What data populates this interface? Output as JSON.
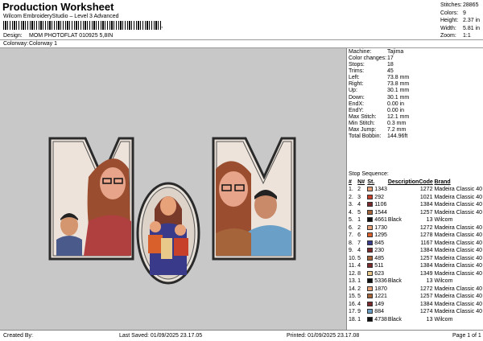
{
  "header": {
    "title": "Production Worksheet",
    "subtitle": "Wilcom EmbroideryStudio – Level 3 Advanced",
    "barcode_suffix": ","
  },
  "design": {
    "label": "Design:",
    "value": "MOM PHOTOFLAT 010925 5,8IN"
  },
  "colorway": {
    "label": "Colorway:",
    "value": "Colorway 1"
  },
  "stats": [
    {
      "label": "Stitches:",
      "value": "28865"
    },
    {
      "label": "Colors:",
      "value": "9"
    },
    {
      "label": "Height:",
      "value": "2.37 in"
    },
    {
      "label": "Width:",
      "value": "5.81 in"
    },
    {
      "label": "Zoom:",
      "value": "1:1"
    }
  ],
  "machine": [
    {
      "label": "Machine:",
      "value": "Tajima"
    },
    {
      "label": "Color changes:",
      "value": "17"
    },
    {
      "label": "Stops:",
      "value": "18"
    },
    {
      "label": "Trims:",
      "value": "45"
    },
    {
      "label": "Left:",
      "value": "73.8 mm"
    },
    {
      "label": "Right:",
      "value": "73.8 mm"
    },
    {
      "label": "Up:",
      "value": "30.1 mm"
    },
    {
      "label": "Down:",
      "value": "30.1 mm"
    },
    {
      "label": "EndX:",
      "value": "0.00 in"
    },
    {
      "label": "EndY:",
      "value": "0.00 in"
    },
    {
      "label": "Max Stitch:",
      "value": "12.1 mm"
    },
    {
      "label": "Min Stitch:",
      "value": "0.3 mm"
    },
    {
      "label": "Max Jump:",
      "value": "7.2 mm"
    },
    {
      "label": "Total Bobbin:",
      "value": "144.96ft"
    }
  ],
  "sequence": {
    "title": "Stop Sequence:",
    "headers": [
      "#",
      "N#",
      "St.",
      "Description",
      "Code",
      "Brand"
    ],
    "rows": [
      {
        "n": "1.",
        "nn": "2",
        "color": "#e8a27a",
        "st": "1343",
        "desc": "",
        "code": "1272",
        "brand": "Madeira Classic 40"
      },
      {
        "n": "2.",
        "nn": "3",
        "color": "#c6402a",
        "st": "292",
        "desc": "",
        "code": "1021",
        "brand": "Madeira Classic 40"
      },
      {
        "n": "3.",
        "nn": "4",
        "color": "#7a2a2a",
        "st": "1106",
        "desc": "",
        "code": "1384",
        "brand": "Madeira Classic 40"
      },
      {
        "n": "4.",
        "nn": "5",
        "color": "#a5643a",
        "st": "1544",
        "desc": "",
        "code": "1257",
        "brand": "Madeira Classic 40"
      },
      {
        "n": "5.",
        "nn": "1",
        "color": "#111111",
        "st": "4661",
        "desc": "Black",
        "code": "13",
        "brand": "Wilcom"
      },
      {
        "n": "6.",
        "nn": "2",
        "color": "#e8a27a",
        "st": "1730",
        "desc": "",
        "code": "1272",
        "brand": "Madeira Classic 40"
      },
      {
        "n": "7.",
        "nn": "6",
        "color": "#d9602a",
        "st": "1295",
        "desc": "",
        "code": "1278",
        "brand": "Madeira Classic 40"
      },
      {
        "n": "8.",
        "nn": "7",
        "color": "#3a3a8a",
        "st": "845",
        "desc": "",
        "code": "1167",
        "brand": "Madeira Classic 40"
      },
      {
        "n": "9.",
        "nn": "4",
        "color": "#7a2a2a",
        "st": "230",
        "desc": "",
        "code": "1384",
        "brand": "Madeira Classic 40"
      },
      {
        "n": "10.",
        "nn": "5",
        "color": "#a5643a",
        "st": "485",
        "desc": "",
        "code": "1257",
        "brand": "Madeira Classic 40"
      },
      {
        "n": "11.",
        "nn": "4",
        "color": "#7a2a2a",
        "st": "511",
        "desc": "",
        "code": "1384",
        "brand": "Madeira Classic 40"
      },
      {
        "n": "12.",
        "nn": "8",
        "color": "#e9c98a",
        "st": "623",
        "desc": "",
        "code": "1349",
        "brand": "Madeira Classic 40"
      },
      {
        "n": "13.",
        "nn": "1",
        "color": "#111111",
        "st": "5336",
        "desc": "Black",
        "code": "13",
        "brand": "Wilcom"
      },
      {
        "n": "14.",
        "nn": "2",
        "color": "#e8a27a",
        "st": "1870",
        "desc": "",
        "code": "1272",
        "brand": "Madeira Classic 40"
      },
      {
        "n": "15.",
        "nn": "5",
        "color": "#a5643a",
        "st": "1221",
        "desc": "",
        "code": "1257",
        "brand": "Madeira Classic 40"
      },
      {
        "n": "16.",
        "nn": "4",
        "color": "#7a2a2a",
        "st": "149",
        "desc": "",
        "code": "1384",
        "brand": "Madeira Classic 40"
      },
      {
        "n": "17.",
        "nn": "9",
        "color": "#6aa0c8",
        "st": "884",
        "desc": "",
        "code": "1274",
        "brand": "Madeira Classic 40"
      },
      {
        "n": "18.",
        "nn": "1",
        "color": "#111111",
        "st": "4738",
        "desc": "Black",
        "code": "13",
        "brand": "Wilcom"
      }
    ]
  },
  "footer": {
    "created": "Created By:",
    "saved": "Last Saved: 01/09/2025 23.17.05",
    "printed": "Printed: 01/09/2025 23.17.08",
    "page": "Page 1 of 1"
  }
}
